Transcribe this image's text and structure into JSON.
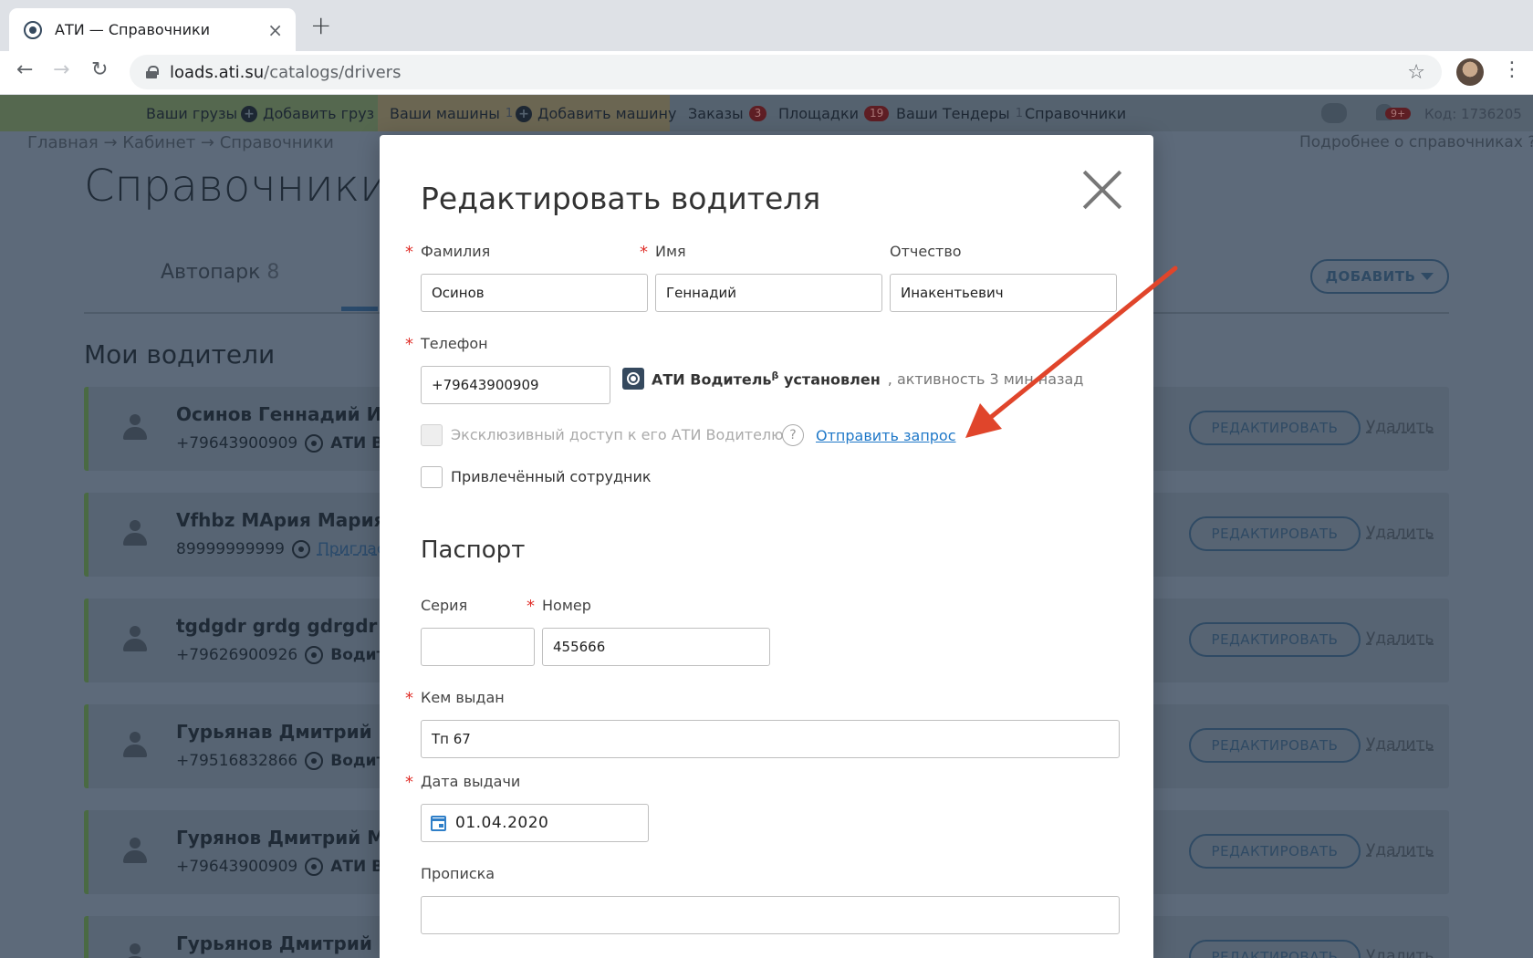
{
  "browser": {
    "tab_title": "АТИ — Справочники",
    "tab_close": "×",
    "new_tab": "+",
    "url_host": "loads.ati.su",
    "url_path": "/catalogs/drivers",
    "back": "←",
    "forward": "→",
    "reload": "↻",
    "star": "☆",
    "menu": "⋮"
  },
  "topnav": {
    "items": [
      {
        "label": "Ваши грузы"
      },
      {
        "label": "Добавить груз"
      },
      {
        "label": "Ваши машины",
        "count": "1"
      },
      {
        "label": "Добавить машину"
      },
      {
        "label": "Заказы",
        "badge": "3"
      },
      {
        "label": "Площадки",
        "badge": "19"
      },
      {
        "label": "Ваши Тендеры",
        "count": "1"
      },
      {
        "label": "Справочники"
      }
    ],
    "notif_badge": "9+",
    "code": "Код: 1736205"
  },
  "page": {
    "breadcrumb": "Главная → Кабинет → Справочники",
    "help_link": "Подробнее о справочниках",
    "help_icon": "?",
    "title": "Справочники",
    "tab_autopark": "Автопарк",
    "tab_autopark_count": "8",
    "add_button": "ДОБАВИТЬ",
    "section_title": "Мои водители",
    "edit_label": "РЕДАКТИРОВАТЬ",
    "delete_label": "Удалить",
    "drivers": [
      {
        "name": "Осинов Геннадий Ин",
        "phone": "+79643900909",
        "tag": "АТИ Во"
      },
      {
        "name": "Vfhbz МАрия Мария",
        "phone": "89999999999",
        "tag": "Пригласи"
      },
      {
        "name": "tgdgdr grdg gdrgdr",
        "phone": "+79626900926",
        "tag": "Водите"
      },
      {
        "name": "Гурьянав Дмитрий М",
        "phone": "+79516832866",
        "tag": "Водите"
      },
      {
        "name": "Гурянов Дмитрий Ми",
        "phone": "+79643900909",
        "tag": "АТИ Во"
      },
      {
        "name": "Гурьянов Дмитрий М",
        "phone": "",
        "tag": ""
      }
    ]
  },
  "modal": {
    "title": "Редактировать водителя",
    "lastname_label": "Фамилия",
    "lastname_value": "Осинов",
    "firstname_label": "Имя",
    "firstname_value": "Геннадий",
    "middlename_label": "Отчество",
    "middlename_value": "Инакентьевич",
    "phone_label": "Телефон",
    "phone_value": "+79643900909",
    "ati_app_name": "АТИ Водитель",
    "ati_app_beta": "β",
    "ati_installed": "установлен",
    "ati_activity": ", активность 3 мин назад",
    "exclusive_label": "Эксклюзивный доступ к его АТИ Водителю",
    "help_icon": "?",
    "send_request": "Отправить запрос",
    "attracted_label": "Привлечённый сотрудник",
    "passport_heading": "Паспорт",
    "series_label": "Серия",
    "series_value": "",
    "number_label": "Номер",
    "number_value": "455666",
    "issued_by_label": "Кем выдан",
    "issued_by_value": "Тп 67",
    "issue_date_label": "Дата выдачи",
    "issue_date_value": "01.04.2020",
    "registration_label": "Прописка",
    "registration_value": ""
  },
  "colors": {
    "accent_link": "#1f78c8",
    "required": "#e0312b",
    "annotation_arrow": "#e0452b"
  }
}
